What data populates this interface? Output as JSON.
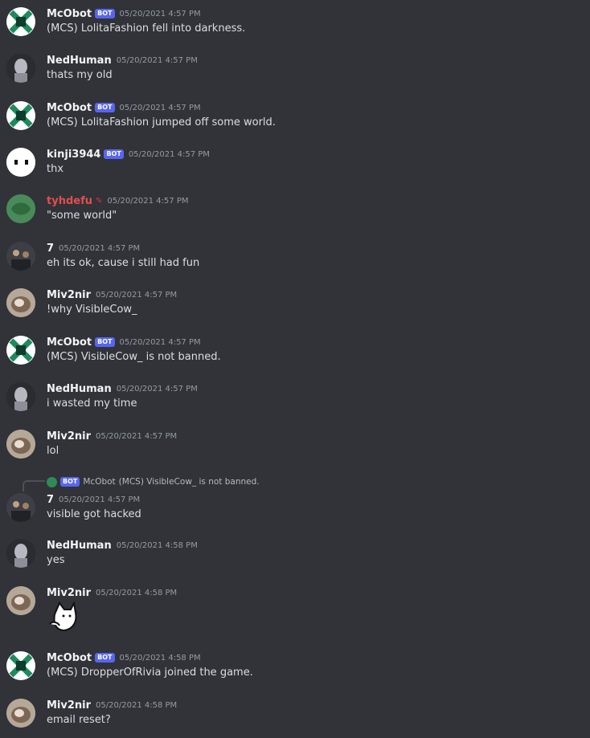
{
  "colors": {
    "background": "#313338",
    "bot_tag": "#5865f2",
    "tyhdefu_name": "#e34e4e"
  },
  "messages": [
    {
      "author": "McObot",
      "bot": "BOT",
      "time": "05/20/2021 4:57 PM",
      "text": "(MCS) LolitaFashion fell into darkness.",
      "avatar": "mcobot-icon"
    },
    {
      "author": "NedHuman",
      "time": "05/20/2021 4:57 PM",
      "text": "thats my old",
      "avatar": "nedhuman-avatar"
    },
    {
      "author": "McObot",
      "bot": "BOT",
      "time": "05/20/2021 4:57 PM",
      "text": "(MCS) LolitaFashion jumped off some world.",
      "avatar": "mcobot-icon"
    },
    {
      "author": "kinji3944",
      "bot": "BOT",
      "time": "05/20/2021 4:57 PM",
      "text": "thx",
      "avatar": "kinji-avatar"
    },
    {
      "author": "tyhdefu",
      "time": "05/20/2021 4:57 PM",
      "text": "\"some world\"",
      "avatar": "tyhdefu-avatar"
    },
    {
      "author": "7",
      "time": "05/20/2021 4:57 PM",
      "text": "eh its ok, cause i still had fun",
      "avatar": "seven-avatar"
    },
    {
      "author": "Miv2nir",
      "time": "05/20/2021 4:57 PM",
      "text": "!why VisibleCow_",
      "avatar": "miv2nir-avatar"
    },
    {
      "author": "McObot",
      "bot": "BOT",
      "time": "05/20/2021 4:57 PM",
      "text": "(MCS) VisibleCow_ is not banned.",
      "avatar": "mcobot-icon"
    },
    {
      "author": "NedHuman",
      "time": "05/20/2021 4:57 PM",
      "text": "i wasted my time",
      "avatar": "nedhuman-avatar"
    },
    {
      "author": "Miv2nir",
      "time": "05/20/2021 4:57 PM",
      "text": "lol",
      "avatar": "miv2nir-avatar"
    },
    {
      "author": "7",
      "time": "05/20/2021 4:57 PM",
      "text": "visible got hacked",
      "avatar": "seven-avatar",
      "reply": {
        "author": "McObot",
        "bot": "BOT",
        "text": "(MCS) VisibleCow_ is not banned."
      }
    },
    {
      "author": "NedHuman",
      "time": "05/20/2021 4:58 PM",
      "text": "yes",
      "avatar": "nedhuman-avatar"
    },
    {
      "author": "Miv2nir",
      "time": "05/20/2021 4:58 PM",
      "text": "",
      "avatar": "miv2nir-avatar",
      "sticker": "thinking-cat-emoji"
    },
    {
      "author": "McObot",
      "bot": "BOT",
      "time": "05/20/2021 4:58 PM",
      "text": "(MCS) DropperOfRivia joined the game.",
      "avatar": "mcobot-icon"
    },
    {
      "author": "Miv2nir",
      "time": "05/20/2021 4:58 PM",
      "text": "email reset?",
      "avatar": "miv2nir-avatar"
    }
  ]
}
